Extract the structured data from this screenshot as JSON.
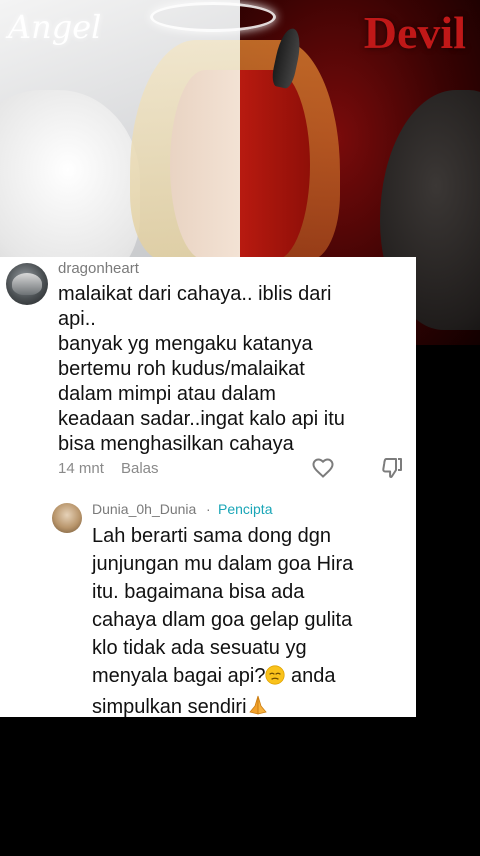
{
  "hero": {
    "angel_label": "Angel",
    "devil_label": "Devil"
  },
  "comment": {
    "username": "dragonheart",
    "text": "malaikat dari cahaya.. iblis dari\napi..\nbanyak yg mengaku katanya\nbertemu roh kudus/malaikat\ndalam mimpi atau dalam\nkeadaan sadar..ingat kalo api itu\nbisa menghasilkan cahaya",
    "time": "14 mnt",
    "reply_label": "Balas",
    "like_icon": "heart-outline-icon",
    "dislike_icon": "thumbs-down-icon"
  },
  "reply": {
    "username": "Dunia_0h_Dunia",
    "separator": "·",
    "badge": "Pencipta",
    "text_part1": "Lah berarti sama dong dgn\njunjungan mu dalam goa Hira\nitu. bagaimana bisa ada\ncahaya dlam goa gelap gulita\nklo tidak ada sesuatu yg\nmenyala bagai api?",
    "text_part2": " anda\nsimpulkan sendiri",
    "emoji_1": "sleepy-face-emoji",
    "emoji_2": "folded-hands-emoji"
  },
  "colors": {
    "creator_badge": "#1aa6b7",
    "meta_text": "#8a8a8a",
    "devil_red": "#c01818"
  }
}
